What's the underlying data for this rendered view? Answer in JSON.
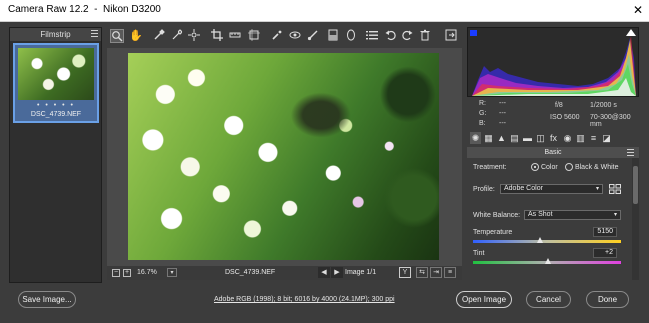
{
  "window": {
    "title": "Camera Raw 12.2  -  Nikon D3200",
    "close": "✕"
  },
  "filmstrip": {
    "header": "Filmstrip",
    "thumb_dots": "• • • • •",
    "thumb_name": "DSC_4739.NEF"
  },
  "toolbar": {
    "tools": [
      "zoom-tool",
      "hand-tool",
      "white-balance-tool",
      "color-sampler-tool",
      "targeted-adjustment-tool",
      "crop-tool",
      "straighten-tool",
      "transform-tool",
      "spot-removal-tool",
      "red-eye-tool",
      "adjustment-brush-tool",
      "graduated-filter-tool",
      "radial-filter-tool",
      "presets-list",
      "rotate-ccw",
      "rotate-cw",
      "delete",
      "toggle-fullscreen"
    ]
  },
  "preview_bar": {
    "zoom_out": "−",
    "zoom_in": "+",
    "zoom_level": "16.7%",
    "zoom_caret": "▾",
    "file_name": "DSC_4739.NEF",
    "prev": "◀",
    "next": "▶",
    "image_count": "Image 1/1",
    "view_y": "Y"
  },
  "info": {
    "r_label": "R:",
    "g_label": "G:",
    "b_label": "B:",
    "r_val": "---",
    "g_val": "---",
    "b_val": "---",
    "aperture": "f/8",
    "shutter": "1/2000 s",
    "iso": "ISO 5600",
    "lens": "70-300@300 mm"
  },
  "panel": {
    "section": "Basic",
    "treatment_label": "Treatment:",
    "treatment_color": "Color",
    "treatment_bw": "Black & White",
    "profile_label": "Profile:",
    "profile_value": "Adobe Color",
    "wb_label": "White Balance:",
    "wb_value": "As Shot",
    "temperature_label": "Temperature",
    "temperature_value": "5150",
    "temperature_level": 0.45,
    "tint_label": "Tint",
    "tint_value": "+2",
    "tint_level": 0.51
  },
  "footer": {
    "save_image": "Save Image...",
    "workflow": "Adobe RGB (1998); 8 bit; 6016 by 4000 (24.1MP); 300 ppi",
    "open_image": "Open Image",
    "cancel": "Cancel",
    "done": "Done"
  },
  "colors": {
    "accent": "#6aa0e6",
    "shadow_clip": "#1a3cff",
    "highlight_clip": "#ffffff"
  }
}
